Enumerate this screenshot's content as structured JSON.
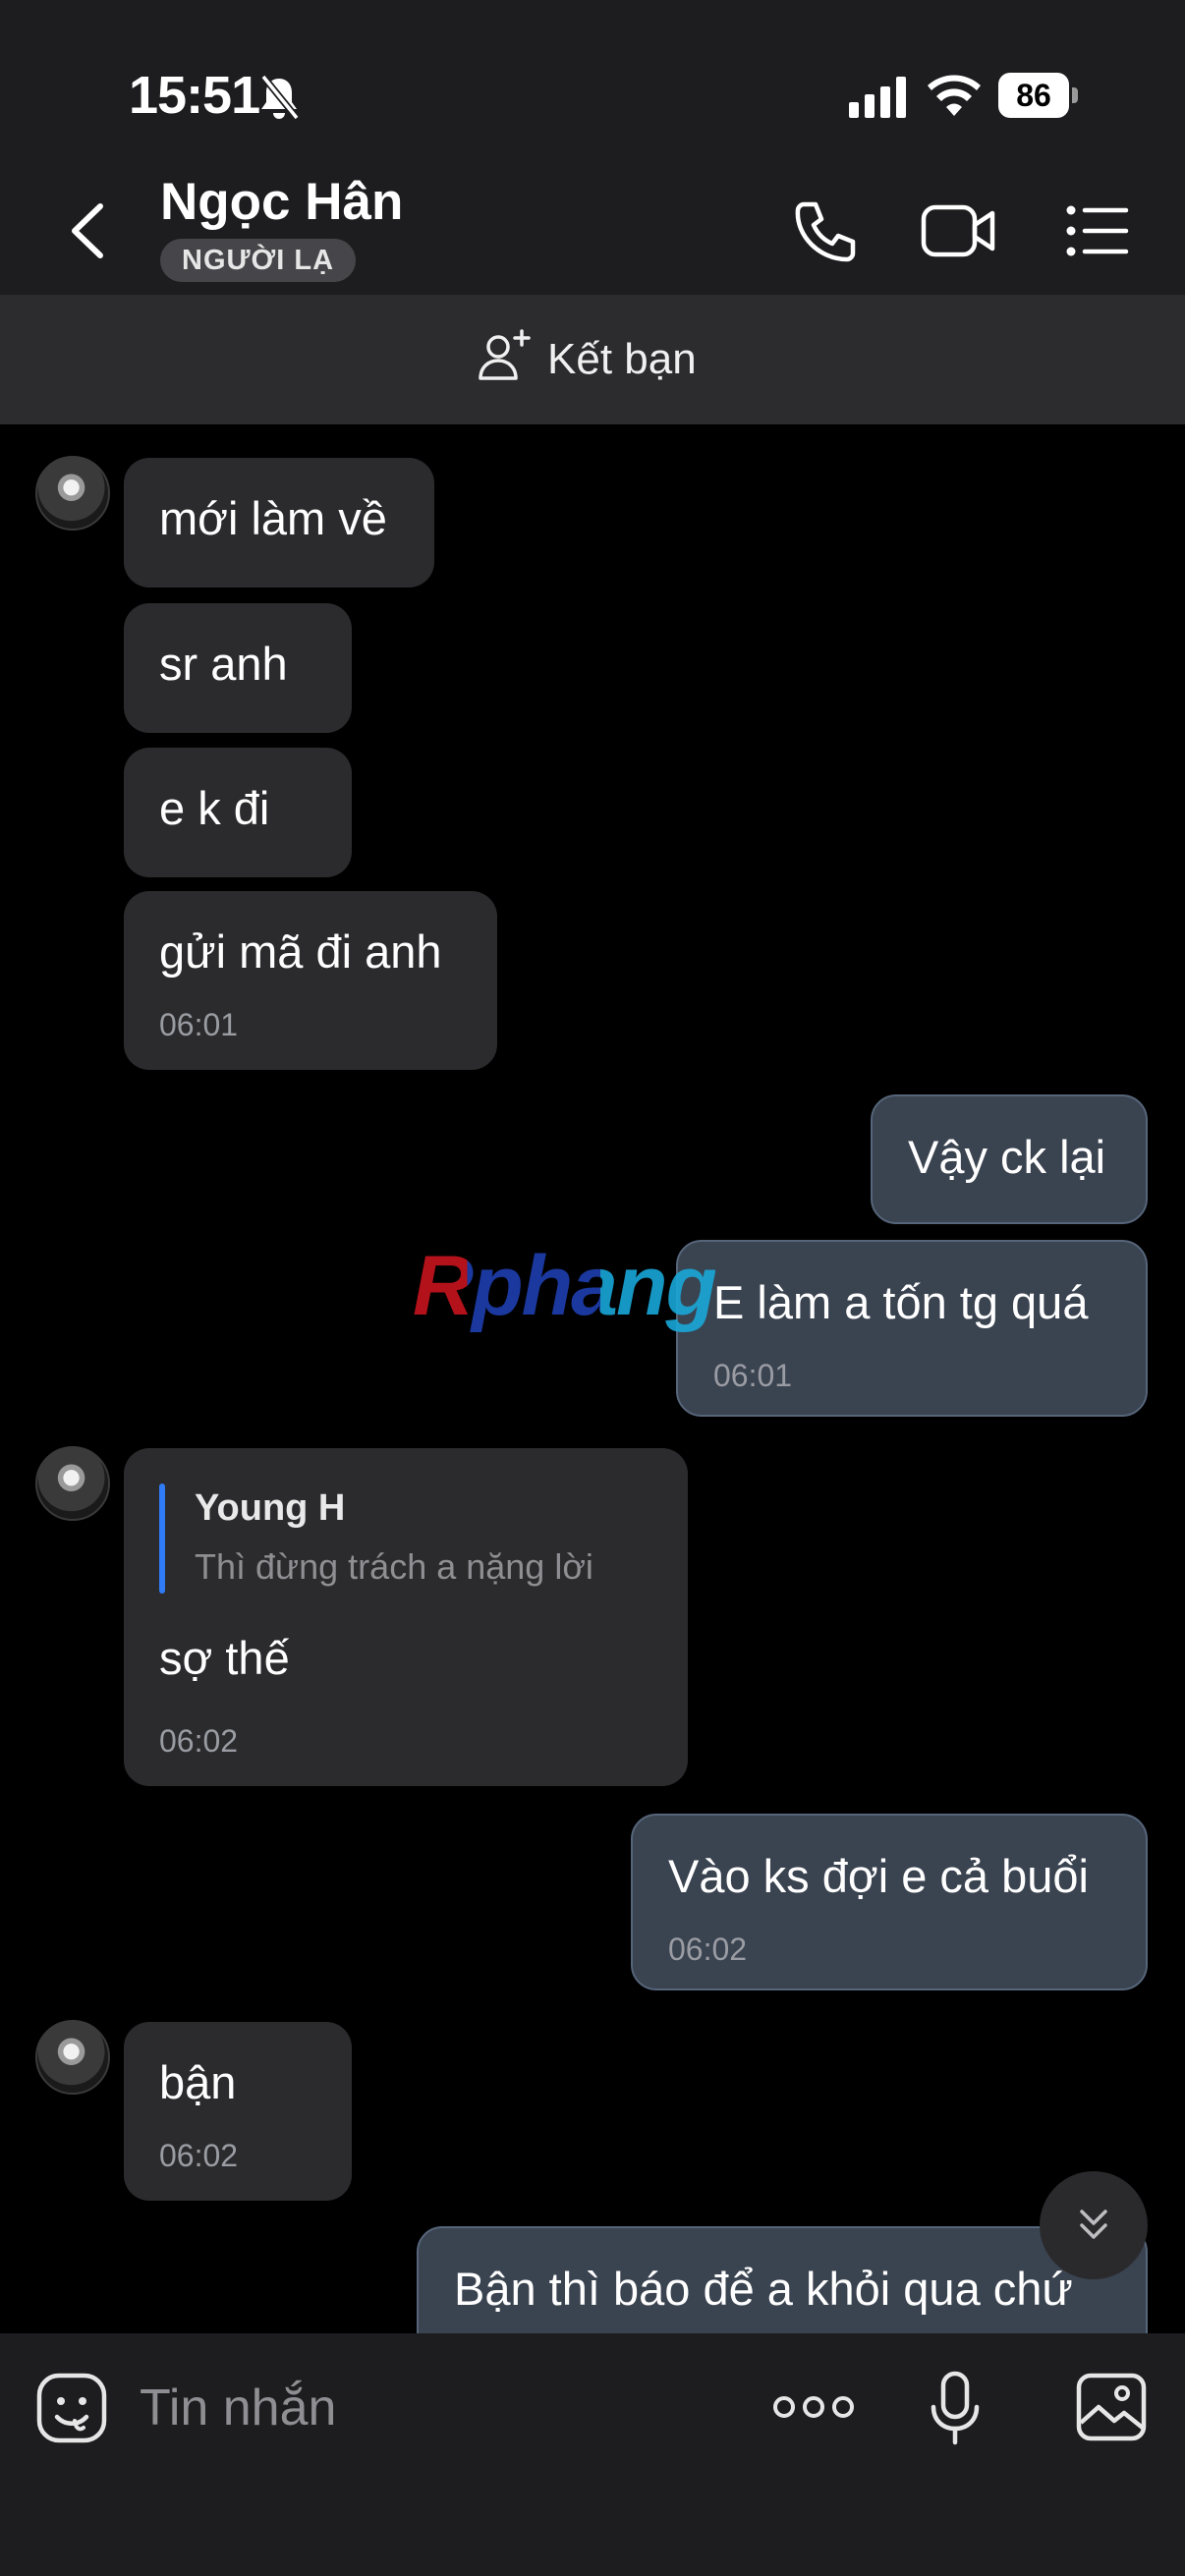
{
  "status": {
    "time": "15:51",
    "battery": "86"
  },
  "header": {
    "title": "Ngọc Hân",
    "badge": "NGƯỜI LẠ"
  },
  "friend_bar": {
    "label": "Kết bạn"
  },
  "watermark": "Rphang",
  "messages": [
    {
      "side": "in",
      "text": "mới làm về"
    },
    {
      "side": "in",
      "text": "sr anh"
    },
    {
      "side": "in",
      "text": "e k đi"
    },
    {
      "side": "in",
      "text": "gửi mã đi anh",
      "time": "06:01"
    },
    {
      "side": "out",
      "text": "Vậy ck lại"
    },
    {
      "side": "out",
      "text": "E làm a tốn tg quá",
      "time": "06:01"
    },
    {
      "side": "in",
      "quote": {
        "author": "Young H",
        "text": "Thì đừng trách a nặng lời"
      },
      "text": "sợ thế",
      "time": "06:02"
    },
    {
      "side": "out",
      "text": "Vào ks đợi e cả buổi",
      "time": "06:02"
    },
    {
      "side": "in",
      "text": "bận",
      "time": "06:02"
    },
    {
      "side": "out",
      "text": "Bận thì báo để a khỏi qua chứ"
    }
  ],
  "composer": {
    "placeholder": "Tin nhắn"
  }
}
